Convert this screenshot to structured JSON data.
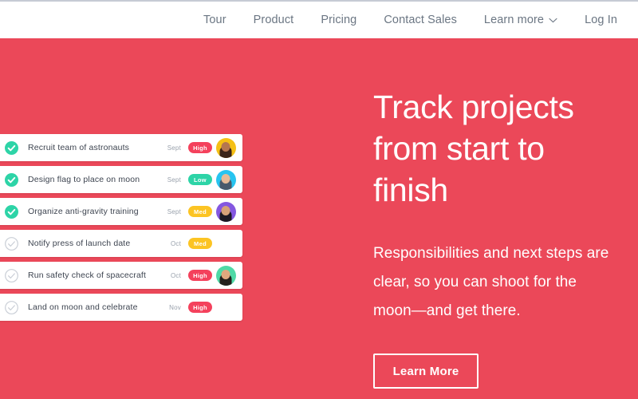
{
  "colors": {
    "hero_background": "#eb4859",
    "nav_text": "#6b7683",
    "badge_high": "#f4415c",
    "badge_low": "#2dd4a7",
    "badge_med": "#fcc423",
    "check_done": "#2dd4a7",
    "check_todo": "#c9ced6"
  },
  "nav": {
    "items": [
      {
        "label": "Tour",
        "icon": null
      },
      {
        "label": "Product",
        "icon": null
      },
      {
        "label": "Pricing",
        "icon": null
      },
      {
        "label": "Contact Sales",
        "icon": null
      },
      {
        "label": "Learn more",
        "icon": "chevron-down-icon"
      },
      {
        "label": "Log In",
        "icon": null
      }
    ]
  },
  "hero": {
    "headline": "Track projects\nfrom start to\nfinish",
    "subcopy": "Responsibilities and next steps are\nclear, so you can shoot for the\nmoon—and get there.",
    "cta_label": "Learn More"
  },
  "tasks": [
    {
      "title": "Recruit team of astronauts",
      "date": "Sept",
      "priority": "High",
      "priority_color": "#f4415c",
      "done": true,
      "avatar": true,
      "avatar_bg": "#f5c016",
      "avatar_skin": "#b4764f",
      "avatar_hair": "#3a2318"
    },
    {
      "title": "Design flag to place on moon",
      "date": "Sept",
      "priority": "Low",
      "priority_color": "#2dd4a7",
      "done": true,
      "avatar": true,
      "avatar_bg": "#27c4f0",
      "avatar_skin": "#e7bb97",
      "avatar_hair": "#4a5a6b"
    },
    {
      "title": "Organize anti-gravity training",
      "date": "Sept",
      "priority": "Med",
      "priority_color": "#fcc423",
      "done": true,
      "avatar": true,
      "avatar_bg": "#8457e0",
      "avatar_skin": "#d6a278",
      "avatar_hair": "#1d1a22"
    },
    {
      "title": "Notify press of launch date",
      "date": "Oct",
      "priority": "Med",
      "priority_color": "#fcc423",
      "done": false,
      "avatar": false,
      "avatar_bg": null,
      "avatar_skin": null,
      "avatar_hair": null
    },
    {
      "title": "Run safety check of spacecraft",
      "date": "Oct",
      "priority": "High",
      "priority_color": "#f4415c",
      "done": false,
      "avatar": true,
      "avatar_bg": "#4fd9a6",
      "avatar_skin": "#e0a87e",
      "avatar_hair": "#24201c"
    },
    {
      "title": "Land on moon and celebrate",
      "date": "Nov",
      "priority": "High",
      "priority_color": "#f4415c",
      "done": false,
      "avatar": false,
      "avatar_bg": null,
      "avatar_skin": null,
      "avatar_hair": null
    }
  ]
}
